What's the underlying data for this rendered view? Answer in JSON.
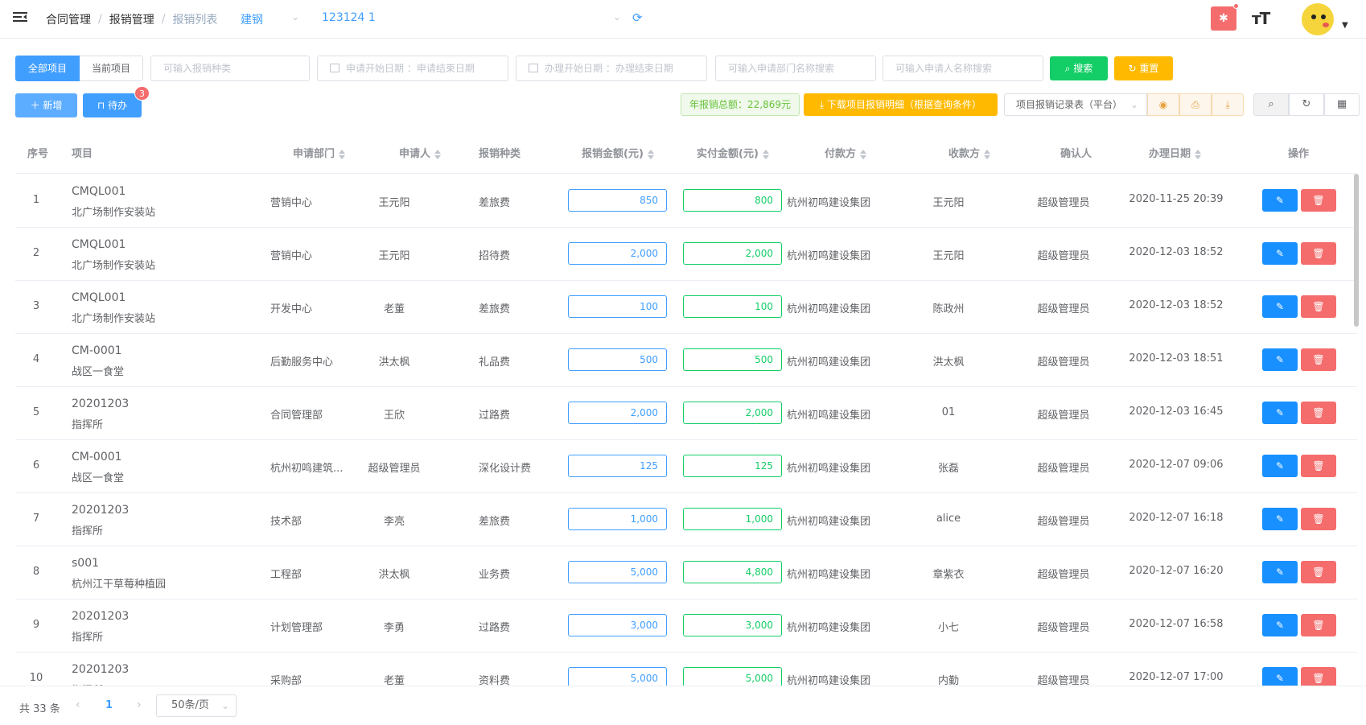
{
  "header": {
    "breadcrumbs": [
      "合同管理",
      "报销管理",
      "报销列表"
    ],
    "project_select": "建钢",
    "project_value": "123124 1",
    "icons": [
      "hamburger-icon",
      "chevron-down-icon",
      "refresh-icon",
      "bug-icon",
      "font-size-icon",
      "avatar",
      "caret-down-icon"
    ]
  },
  "filters": {
    "segments": [
      "全部项目",
      "当前项目"
    ],
    "type_placeholder": "可输入报销种类",
    "apply_date": "申请开始日期 ：申请结束日期",
    "handle_date": "办理开始日期 ：办理结束日期",
    "dept_placeholder": "可输入申请部门名称搜索",
    "applicant_placeholder": "可输入申请人名称搜索",
    "search_label": "搜索",
    "reset_label": "重置"
  },
  "toolbar": {
    "add_label": "新增",
    "todo_label": "待办",
    "todo_badge": "3",
    "total_text": "年报销总额：22,869元",
    "download_label": "下载项目报销明细（根据查询条件）",
    "record_select": "项目报销记录表（平台）"
  },
  "table": {
    "columns": [
      "序号",
      "项目",
      "申请部门",
      "申请人",
      "报销种类",
      "报销金额(元)",
      "实付金额(元)",
      "付款方",
      "收款方",
      "确认人",
      "办理日期",
      "操作"
    ],
    "rows": [
      {
        "no": "1",
        "code": "CMQL001",
        "name": "北广场制作安装站",
        "dept": "营销中心",
        "applicant": "王元阳",
        "type": "差旅费",
        "amount": "850",
        "paid": "800",
        "payer": "杭州初鸣建设集团",
        "payee": "王元阳",
        "confirmer": "超级管理员",
        "date": "2020-11-25 20:39"
      },
      {
        "no": "2",
        "code": "CMQL001",
        "name": "北广场制作安装站",
        "dept": "营销中心",
        "applicant": "王元阳",
        "type": "招待费",
        "amount": "2,000",
        "paid": "2,000",
        "payer": "杭州初鸣建设集团",
        "payee": "王元阳",
        "confirmer": "超级管理员",
        "date": "2020-12-03 18:52"
      },
      {
        "no": "3",
        "code": "CMQL001",
        "name": "北广场制作安装站",
        "dept": "开发中心",
        "applicant": "老董",
        "type": "差旅费",
        "amount": "100",
        "paid": "100",
        "payer": "杭州初鸣建设集团",
        "payee": "陈政州",
        "confirmer": "超级管理员",
        "date": "2020-12-03 18:52"
      },
      {
        "no": "4",
        "code": "CM-0001",
        "name": "战区一食堂",
        "dept": "后勤服务中心",
        "applicant": "洪太枫",
        "type": "礼品费",
        "amount": "500",
        "paid": "500",
        "payer": "杭州初鸣建设集团",
        "payee": "洪太枫",
        "confirmer": "超级管理员",
        "date": "2020-12-03 18:51"
      },
      {
        "no": "5",
        "code": "20201203",
        "name": "指挥所",
        "dept": "合同管理部",
        "applicant": "王欣",
        "type": "过路费",
        "amount": "2,000",
        "paid": "2,000",
        "payer": "杭州初鸣建设集团",
        "payee": "01",
        "confirmer": "超级管理员",
        "date": "2020-12-03 16:45"
      },
      {
        "no": "6",
        "code": "CM-0001",
        "name": "战区一食堂",
        "dept": "杭州初鸣建筑...",
        "applicant": "超级管理员",
        "type": "深化设计费",
        "amount": "125",
        "paid": "125",
        "payer": "杭州初鸣建设集团",
        "payee": "张磊",
        "confirmer": "超级管理员",
        "date": "2020-12-07 09:06"
      },
      {
        "no": "7",
        "code": "20201203",
        "name": "指挥所",
        "dept": "技术部",
        "applicant": "李亮",
        "type": "差旅费",
        "amount": "1,000",
        "paid": "1,000",
        "payer": "杭州初鸣建设集团",
        "payee": "alice",
        "confirmer": "超级管理员",
        "date": "2020-12-07 16:18"
      },
      {
        "no": "8",
        "code": "s001",
        "name": "杭州江干草莓种植园",
        "dept": "工程部",
        "applicant": "洪太枫",
        "type": "业务费",
        "amount": "5,000",
        "paid": "4,800",
        "payer": "杭州初鸣建设集团",
        "payee": "章紫衣",
        "confirmer": "超级管理员",
        "date": "2020-12-07 16:20"
      },
      {
        "no": "9",
        "code": "20201203",
        "name": "指挥所",
        "dept": "计划管理部",
        "applicant": "李勇",
        "type": "过路费",
        "amount": "3,000",
        "paid": "3,000",
        "payer": "杭州初鸣建设集团",
        "payee": "小七",
        "confirmer": "超级管理员",
        "date": "2020-12-07 16:58"
      },
      {
        "no": "10",
        "code": "20201203",
        "name": "指挥所",
        "dept": "采购部",
        "applicant": "老董",
        "type": "资料费",
        "amount": "5,000",
        "paid": "5,000",
        "payer": "杭州初鸣建设集团",
        "payee": "内勤",
        "confirmer": "超级管理员",
        "date": "2020-12-07 17:00"
      }
    ]
  },
  "pagination": {
    "total": "共 33 条",
    "current_page": "1",
    "page_size": "50条/页"
  },
  "colors": {
    "primary": "#409eff",
    "success": "#13ce66",
    "warning": "#ffba00",
    "danger": "#f56c6c"
  }
}
